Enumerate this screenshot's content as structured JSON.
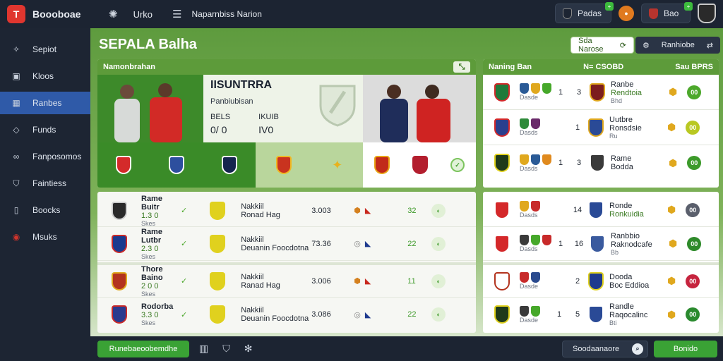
{
  "app": {
    "name": "Boooboae",
    "logo_letter": "T",
    "section": "Urko",
    "nav_title": "Naparnbiss Narion"
  },
  "top_right": {
    "account_label": "Padas",
    "notif_badge": "+",
    "user_label": "Bao",
    "user_badge": "+"
  },
  "sidebar": {
    "items": [
      {
        "label": "Sepiot",
        "icon": "star-icon"
      },
      {
        "label": "Kloos",
        "icon": "box-icon"
      },
      {
        "label": "Ranbes",
        "icon": "grid-icon",
        "active": true
      },
      {
        "label": "Funds",
        "icon": "tag-icon"
      },
      {
        "label": "Fanposomos",
        "icon": "link-icon"
      },
      {
        "label": "Faintiess",
        "icon": "shield-icon"
      },
      {
        "label": "Boocks",
        "icon": "bookmark-icon"
      },
      {
        "label": "Msuks",
        "icon": "ball-icon"
      }
    ]
  },
  "header": {
    "title": "SEPALA Balha",
    "button1": "Sda Narose",
    "button2": "Ranhiobe"
  },
  "featured": {
    "head_label": "Namonbrahan",
    "match_title": "IISUNTRRA",
    "subtitle": "Panbiubisan",
    "stat1_label": "BELS",
    "stat1_value": "0/ 0",
    "stat2_label": "IKUIB",
    "stat2_value": "IV0"
  },
  "standings": {
    "head_left": "Naning Ban",
    "head_mid": "N= CSOBD",
    "head_right": "Sau BPRS"
  },
  "matches": [
    {
      "team": "Rame Buitr",
      "sub1": "1.3 0",
      "sub2": "Skes",
      "opponent": "Nakkiil",
      "detail": "Ronad Hag",
      "odds": "3.003",
      "score": "32"
    },
    {
      "team": "Rame Lutbr",
      "sub1": "2.3 0",
      "sub2": "Skes",
      "opponent": "Nakkiil",
      "detail": "Deuanin Foocdotna",
      "odds": "73.36",
      "score": "22"
    },
    {
      "team": "Thore Baino",
      "sub1": "2 0 0",
      "sub2": "Skes",
      "opponent": "Nakkiil",
      "detail": "Ranad Hag",
      "odds": "3.006",
      "score": "11"
    },
    {
      "team": "Rodorba",
      "sub1": "3.3 0",
      "sub2": "Skes",
      "opponent": "Nakkiil",
      "detail": "Deuanin Foocdotna",
      "odds": "3.086",
      "score": "22"
    }
  ],
  "table_rows": [
    {
      "mid": "1",
      "score": "3",
      "name": "Ranbe",
      "detail": "Rendtoia",
      "tiny": "Bhd",
      "note": "Dasde",
      "badge": "00",
      "badge_color": "#4ca82b"
    },
    {
      "mid": "",
      "score": "1",
      "name": "Uutbre",
      "detail": "Ronsdsie",
      "tiny": "Ru",
      "note": "Dasds",
      "badge": "00",
      "badge_color": "#b9c822"
    },
    {
      "mid": "1",
      "score": "3",
      "name": "Rame",
      "detail": "Bodda",
      "tiny": "",
      "note": "Dasds",
      "badge": "00",
      "badge_color": "#3c9a2a"
    },
    {
      "mid": "",
      "score": "14",
      "name": "Ronde",
      "detail": "Ronkuidia",
      "tiny": "",
      "note": "Dasds",
      "badge": "00",
      "badge_color": "#5a5f6c"
    },
    {
      "mid": "1",
      "score": "16",
      "name": "Ranbbio",
      "detail": "Raknodcafe",
      "tiny": "Bb",
      "note": "Dasds",
      "badge": "00",
      "badge_color": "#2e8a2a"
    },
    {
      "mid": "",
      "score": "2",
      "name": "Dooda",
      "detail": "Boc Eddioa",
      "tiny": "",
      "note": "Dasde",
      "badge": "00",
      "badge_color": "#c6243e"
    },
    {
      "mid": "1",
      "score": "5",
      "name": "Randle",
      "detail": "Raqocalinc",
      "tiny": "Bti",
      "note": "Dasde",
      "badge": "00",
      "badge_color": "#2a8a2e"
    }
  ],
  "bottom": {
    "left_button": "Runebaeoobemdhe",
    "search_label": "Soodaanaore",
    "right_button": "Bonido"
  },
  "colors": {
    "accent": "#5d9b3a",
    "active_nav": "#2f5aa8",
    "dark_bg": "#1c2432"
  }
}
